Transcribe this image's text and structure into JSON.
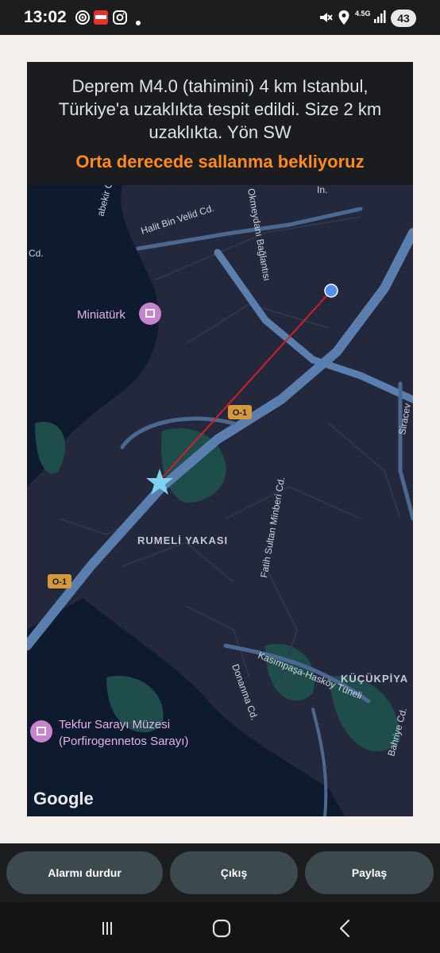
{
  "status_bar": {
    "time": "13:02",
    "battery": "43",
    "network": "4.5G"
  },
  "alert": {
    "message": "Deprem M4.0 (tahimini) 4 km Istanbul, Türkiye'a uzaklıkta tespit edildi. Size 2 km uzaklıkta. Yön SW",
    "warning": "Orta derecede sallanma bekliyoruz",
    "warning_color": "#ff8a1f"
  },
  "map": {
    "labels": {
      "halit": "Halit Bin Velid Cd.",
      "okmeydani": "Okmeydanı Bağlantısı",
      "miniaturk": "Miniatürk",
      "o1_a": "O-1",
      "o1_b": "O-1",
      "rumeli": "RUMELİ YAKASI",
      "fatih": "Fatih Sultan Minberi Cd.",
      "kasimpasa": "Kasımpaşa-Hasköy Tüneli",
      "donanma": "Donanma Cd.",
      "kucukpiyale": "KÜÇÜKPİYA",
      "tekfur_1": "Tekfur Sarayı Müzesi",
      "tekfur_2": "(Porfirogennetos Sarayı)",
      "bahriye": "Bahriye Cd.",
      "siracevizler": "Siracev",
      "abekir": "abekir Cd.",
      "cd_left": "Cd.",
      "in_top": "In.",
      "google": "Google"
    }
  },
  "buttons": {
    "stop_alarm": "Alarmı durdur",
    "exit": "Çıkış",
    "share": "Paylaş"
  }
}
